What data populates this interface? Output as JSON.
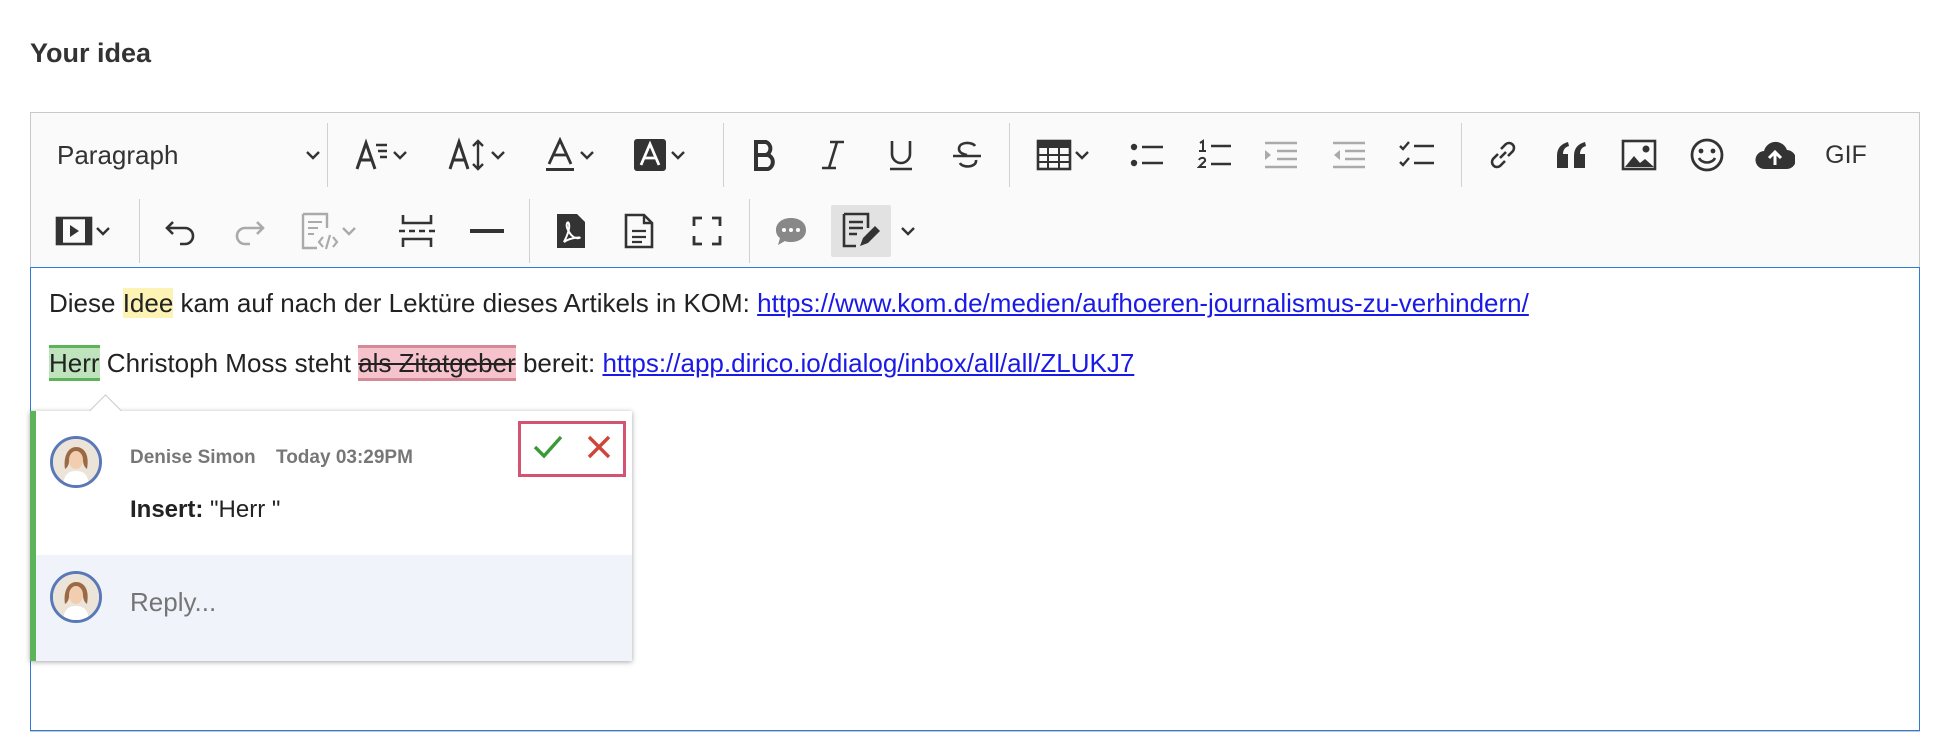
{
  "section_label": "Your idea",
  "toolbar": {
    "paragraph_select": "Paragraph",
    "gif_label": "GIF",
    "row1_icons": [
      "font-size-icon",
      "line-height-icon",
      "font-color-icon",
      "highlight-color-icon",
      "bold-icon",
      "italic-icon",
      "underline-icon",
      "strikethrough-icon",
      "table-icon",
      "bulleted-list-icon",
      "numbered-list-icon",
      "increase-indent-icon",
      "decrease-indent-icon",
      "todo-list-icon",
      "link-icon",
      "blockquote-icon",
      "image-icon",
      "emoji-icon",
      "upload-icon"
    ],
    "row2_icons": [
      "media-embed-icon",
      "undo-icon",
      "redo-icon",
      "source-editing-icon",
      "page-break-icon",
      "horizontal-line-icon",
      "export-pdf-icon",
      "export-word-icon",
      "fullscreen-icon",
      "comment-icon",
      "track-changes-icon"
    ]
  },
  "content": {
    "line1": {
      "before": "Diese ",
      "highlight": "Idee",
      "after": " kam auf nach der Lektüre dieses Artikels in KOM: ",
      "link": "https://www.kom.de/medien/aufhoeren-journalismus-zu-verhindern/"
    },
    "line2": {
      "inserted": "Herr",
      "middle": " Christoph Moss steht ",
      "deleted": "als Zitatgeber",
      "after": " bereit: ",
      "link": "https://app.dirico.io/dialog/inbox/all/all/ZLUKJ7"
    }
  },
  "suggestion": {
    "author": "Denise Simon",
    "time": "Today 03:29PM",
    "action_label": "Insert:",
    "action_value": "\"Herr \"",
    "reply_placeholder": "Reply..."
  },
  "colors": {
    "insert_green": "#5db35a",
    "delete_red": "#d25471",
    "link_blue": "#1a1ae6",
    "focus_blue": "#2f7bd8"
  }
}
